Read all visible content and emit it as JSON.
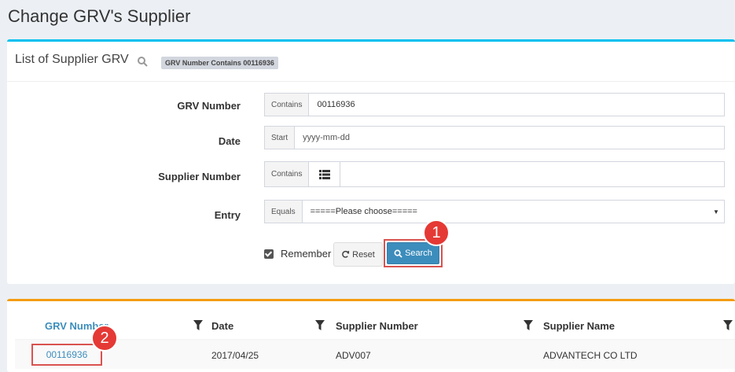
{
  "page": {
    "title": "Change GRV's Supplier"
  },
  "search_panel": {
    "title": "List of Supplier GRV",
    "filter_badge": "GRV Number Contains 00116936",
    "fields": {
      "grv_number": {
        "label": "GRV Number",
        "operator": "Contains",
        "value": "00116936"
      },
      "date": {
        "label": "Date",
        "operator": "Start",
        "placeholder": "yyyy-mm-dd"
      },
      "supplier_number": {
        "label": "Supplier Number",
        "operator": "Contains",
        "value": ""
      },
      "entry": {
        "label": "Entry",
        "operator": "Equals",
        "selected": "=====Please choose====="
      }
    },
    "remember_label": "Remember",
    "remember_checked": true,
    "reset_label": "Reset",
    "search_label": "Search"
  },
  "markers": {
    "one": "1",
    "two": "2"
  },
  "results": {
    "columns": [
      "GRV Number",
      "Date",
      "Supplier Number",
      "Supplier Name"
    ],
    "rows": [
      {
        "grv_number": "00116936",
        "date": "2017/04/25",
        "supplier_number": "ADV007",
        "supplier_name": "ADVANTECH CO LTD"
      }
    ]
  },
  "colors": {
    "search_panel_accent": "#00c0ef",
    "results_panel_accent": "#f39c12",
    "primary": "#3c8dbc",
    "highlight": "#d9534f",
    "marker": "#e53935"
  }
}
